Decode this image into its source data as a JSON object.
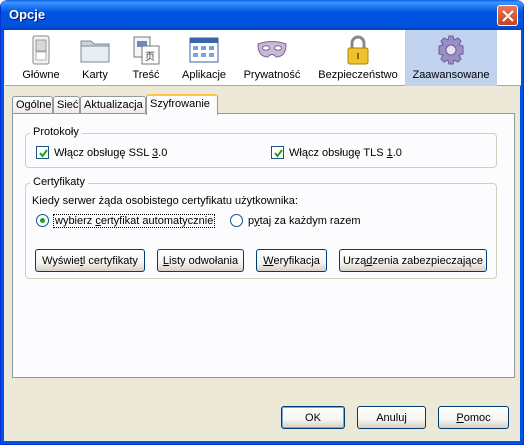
{
  "window": {
    "title": "Opcje"
  },
  "panes": [
    {
      "label": "Główne",
      "icon": "general-switch-icon"
    },
    {
      "label": "Karty",
      "icon": "folder-tabs-icon"
    },
    {
      "label": "Treść",
      "icon": "content-document-icon"
    },
    {
      "label": "Aplikacje",
      "icon": "applications-window-icon"
    },
    {
      "label": "Prywatność",
      "icon": "privacy-mask-icon"
    },
    {
      "label": "Bezpieczeństwo",
      "icon": "security-padlock-icon"
    },
    {
      "label": "Zaawansowane",
      "icon": "advanced-gear-icon",
      "selected": true
    }
  ],
  "subtabs": [
    {
      "label": "Ogólne"
    },
    {
      "label": "Sieć"
    },
    {
      "label": "Aktualizacja"
    },
    {
      "label": "Szyfrowanie",
      "active": true
    }
  ],
  "protocols": {
    "title": "Protokoły",
    "ssl": {
      "label_pre": "Włącz obsługę SSL ",
      "label_ul": "3",
      "label_post": ".0",
      "checked": true
    },
    "tls": {
      "label_pre": "Włącz obsługę TLS ",
      "label_ul": "1",
      "label_post": ".0",
      "checked": true
    }
  },
  "certificates": {
    "title": "Certyfikaty",
    "prompt": "Kiedy serwer żąda osobistego certyfikatu użytkownika:",
    "auto": {
      "label_pre": "wybierz ",
      "label_ul": "c",
      "label_post": "ertyfikat automatycznie",
      "selected": true
    },
    "ask": {
      "label_pre": "p",
      "label_ul": "y",
      "label_post": "taj za każdym razem",
      "selected": false
    },
    "buttons": {
      "view": {
        "pre": "Wyświe",
        "ul": "t",
        "post": "l certyfikaty"
      },
      "revocation": {
        "pre": "",
        "ul": "L",
        "post": "isty odwołania"
      },
      "verification": {
        "pre": "",
        "ul": "W",
        "post": "eryfikacja"
      },
      "devices": {
        "pre": "Urzą",
        "ul": "d",
        "post": "zenia zabezpieczające"
      }
    }
  },
  "dialog_buttons": {
    "ok": "OK",
    "cancel": "Anuluj",
    "help_ul": "P",
    "help_post": "omoc"
  },
  "colors": {
    "accent": "#0054e3",
    "selection": "#c1d2ee",
    "check": "#21a121"
  }
}
